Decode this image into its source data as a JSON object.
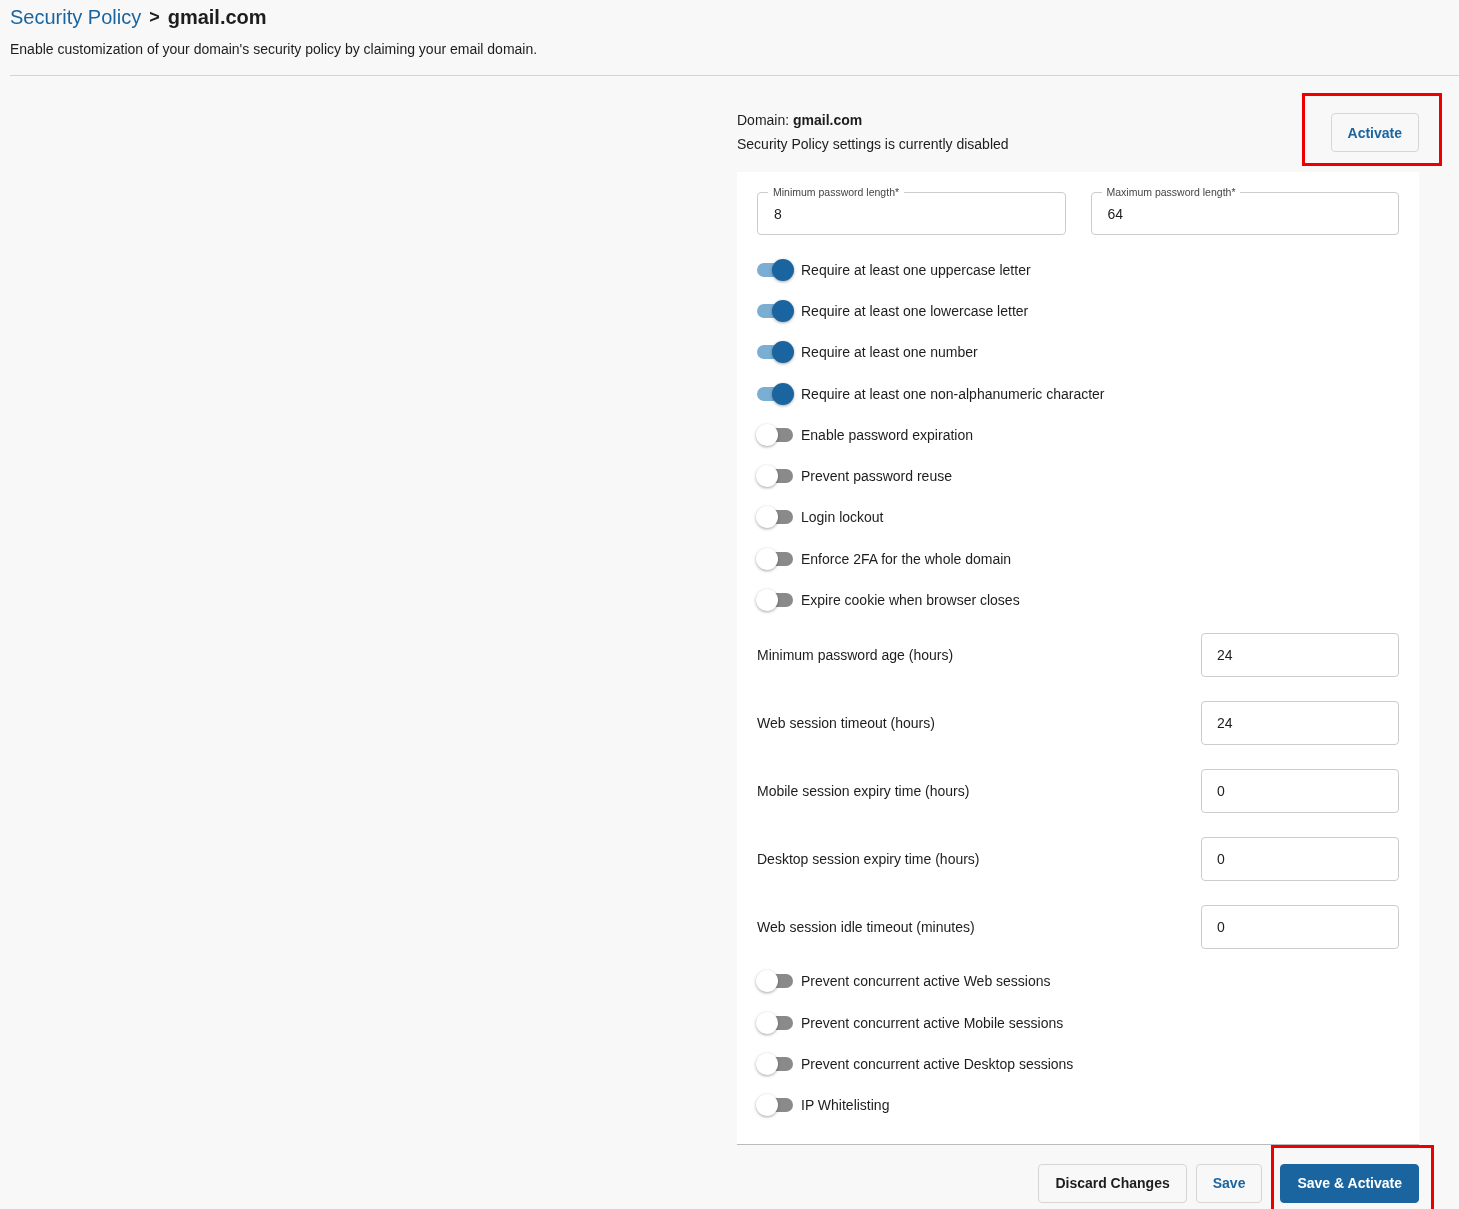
{
  "breadcrumb": {
    "parent": "Security Policy",
    "separator": ">",
    "current": "gmail.com"
  },
  "description": "Enable customization of your domain's security policy by claiming your email domain.",
  "domain_info": {
    "line": "Domain: **gmail.com**",
    "status": "Security Policy settings is currently disabled"
  },
  "activate_button": {
    "label": "Activate",
    "highlighted": true
  },
  "length_fields": [
    {
      "label": "Minimum password length*",
      "value": "8"
    },
    {
      "label": "Maximum password length*",
      "value": "64"
    }
  ],
  "settings": [
    {
      "kind": "toggle",
      "label": "Require at least one uppercase letter",
      "on": true
    },
    {
      "kind": "toggle",
      "label": "Require at least one lowercase letter",
      "on": true
    },
    {
      "kind": "toggle",
      "label": "Require at least one number",
      "on": true
    },
    {
      "kind": "toggle",
      "label": "Require at least one non-alphanumeric character",
      "on": true
    },
    {
      "kind": "toggle",
      "label": "Enable password expiration",
      "on": false
    },
    {
      "kind": "toggle",
      "label": "Prevent password reuse",
      "on": false
    },
    {
      "kind": "toggle",
      "label": "Login lockout",
      "on": false
    },
    {
      "kind": "toggle",
      "label": "Enforce 2FA for the whole domain",
      "on": false
    },
    {
      "kind": "toggle",
      "label": "Expire cookie when browser closes",
      "on": false
    },
    {
      "kind": "number",
      "label": "Minimum password age (hours)",
      "value": "24"
    },
    {
      "kind": "number",
      "label": "Web session timeout (hours)",
      "value": "24"
    },
    {
      "kind": "number",
      "label": "Mobile session expiry time (hours)",
      "value": "0"
    },
    {
      "kind": "number",
      "label": "Desktop session expiry time (hours)",
      "value": "0"
    },
    {
      "kind": "number",
      "label": "Web session idle timeout (minutes)",
      "value": "0"
    },
    {
      "kind": "toggle",
      "label": "Prevent concurrent active Web sessions",
      "on": false
    },
    {
      "kind": "toggle",
      "label": "Prevent concurrent active Mobile sessions",
      "on": false
    },
    {
      "kind": "toggle",
      "label": "Prevent concurrent active Desktop sessions",
      "on": false
    },
    {
      "kind": "toggle",
      "label": "IP Whitelisting",
      "on": false
    }
  ],
  "footer_buttons": [
    {
      "kind": "secondary",
      "label": "Discard Changes",
      "highlighted": false
    },
    {
      "kind": "link",
      "label": "Save",
      "highlighted": false
    },
    {
      "kind": "primary",
      "label": "Save & Activate",
      "highlighted": true
    }
  ]
}
